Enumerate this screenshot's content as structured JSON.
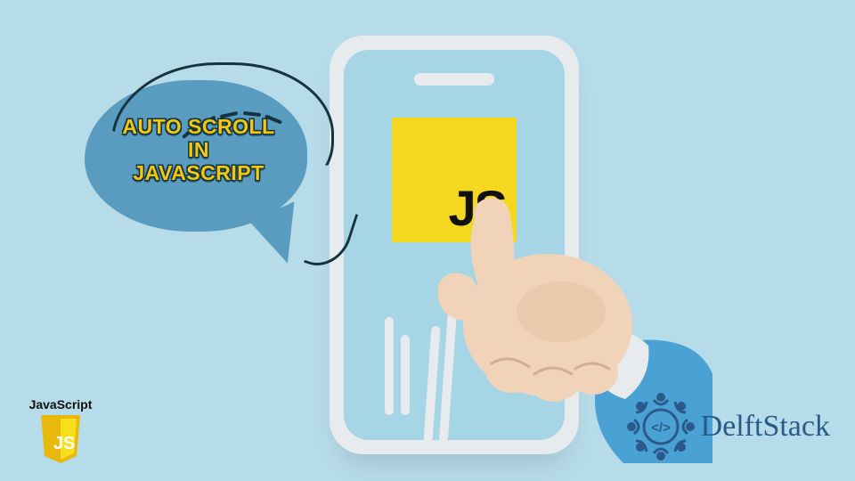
{
  "bubble": {
    "line1": "AUTO SCROLL",
    "line2": "IN",
    "line3": "JAVASCRIPT"
  },
  "phone": {
    "tile_label": "JS"
  },
  "badge": {
    "label": "JavaScript",
    "shield_text": "JS"
  },
  "brand": {
    "name": "DelftStack",
    "mark_glyph": "</>"
  },
  "colors": {
    "background": "#b7dce9",
    "bubble_fill": "#5a9cc0",
    "accent_yellow": "#f2c70f",
    "js_yellow": "#f4d81f",
    "outline_dark": "#16343f",
    "brand_blue": "#2b5a8a"
  }
}
